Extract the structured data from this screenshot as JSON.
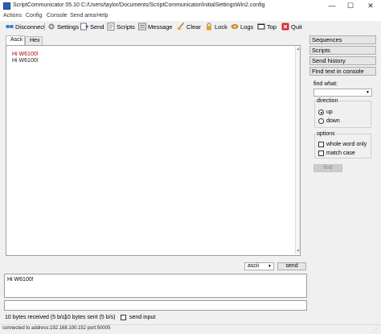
{
  "window": {
    "title": "ScriptCommunicator 05.10   C:/Users/taylor/Documents/ScriptCommunicator/initialSettingsWin2.config",
    "minimize": "—",
    "maximize": "☐",
    "close": "✕"
  },
  "menu": {
    "items": [
      "Actions",
      "Config",
      "Console",
      "Send area",
      "Help"
    ]
  },
  "toolbar": {
    "disconnect": "Disconnect",
    "settings": "Settings",
    "send": "Send",
    "scripts": "Scripts",
    "message": "Message",
    "clear": "Clear",
    "lock": "Lock",
    "logs": "Logs",
    "top": "Top",
    "quit": "Quit"
  },
  "tabs": {
    "ascii": "Ascii",
    "hex": "Hex",
    "active": "Ascii"
  },
  "console": {
    "lines": [
      {
        "text": "Hi W6100!",
        "color": "#b00000"
      },
      {
        "text": "Hi W6100!",
        "color": "#222222"
      }
    ],
    "scroll_up": "▲",
    "scroll_down": "▼"
  },
  "send_area": {
    "format": "ascii",
    "caret": "▼",
    "send_label": "send",
    "input_text": "Hi W6100!",
    "line_value": "",
    "bytes_received": "10 bytes received (5 b/s)",
    "bytes_sent": "10 bytes sent (5 b/s)",
    "send_input_label": "send input",
    "send_input_checked": false
  },
  "side_panel": {
    "sequences": "Sequences",
    "scripts": "Scripts",
    "send_history": "Send history",
    "find_text": "Find text in console",
    "find_what_label": "find what:",
    "find_what_value": "",
    "direction_title": "direction",
    "up_label": "up",
    "down_label": "down",
    "direction_selected": "up",
    "options_title": "options",
    "whole_word_label": "whole word only",
    "match_case_label": "match case",
    "find_button": "find"
  },
  "status": {
    "text": "connected to address:192.168.100.152  port:50005",
    "grip": "⋰"
  },
  "colors": {
    "received_text": "#b00000",
    "window_bg": "#f0f0f0"
  },
  "icons": {
    "disconnect": "disconnect-icon",
    "settings": "gear-icon",
    "send": "send-icon",
    "scripts": "scripts-icon",
    "message": "message-icon",
    "clear": "broom-icon",
    "lock": "lock-icon",
    "logs": "logs-icon",
    "top": "top-window-icon",
    "quit": "quit-icon"
  }
}
